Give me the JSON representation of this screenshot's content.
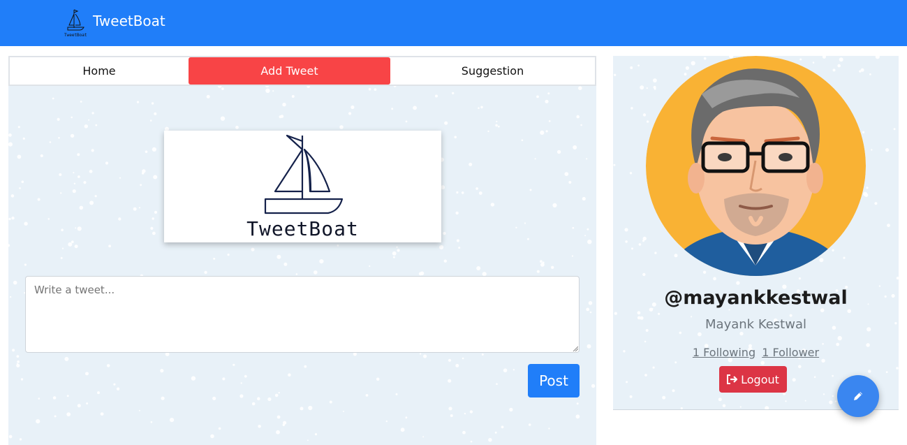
{
  "navbar": {
    "brand_name": "TweetBoat",
    "brand_logo_caption": "TweetBoat",
    "bg_color": "#207ef9"
  },
  "tabs": [
    {
      "label": "Home",
      "active": false
    },
    {
      "label": "Add Tweet",
      "active": true
    },
    {
      "label": "Suggestion",
      "active": false
    }
  ],
  "compose": {
    "logo_text": "TweetBoat",
    "placeholder": "Write a tweet...",
    "value": "",
    "post_label": "Post"
  },
  "profile": {
    "username": "@mayankkestwal",
    "full_name": "Mayank Kestwal",
    "following_label": "1 Following",
    "follower_label": "1 Follower",
    "logout_label": "Logout",
    "logout_icon": "sign-out-icon"
  },
  "fab": {
    "icon": "pencil-icon"
  },
  "colors": {
    "accent": "#207ef9",
    "active_tab": "#f84446",
    "logout": "#dc3545",
    "panel_bg": "#e8f1f8"
  }
}
